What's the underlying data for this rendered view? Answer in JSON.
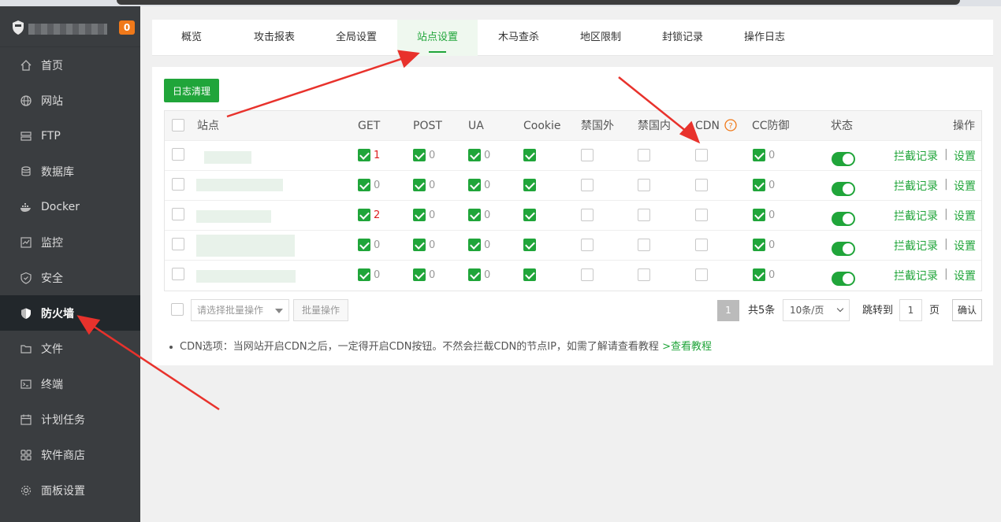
{
  "sidebar": {
    "badge": "0",
    "items": [
      {
        "label": "首页",
        "icon": "home-icon"
      },
      {
        "label": "网站",
        "icon": "globe-icon"
      },
      {
        "label": "FTP",
        "icon": "ftp-icon"
      },
      {
        "label": "数据库",
        "icon": "database-icon"
      },
      {
        "label": "Docker",
        "icon": "docker-icon"
      },
      {
        "label": "监控",
        "icon": "monitor-icon"
      },
      {
        "label": "安全",
        "icon": "security-shield-icon"
      },
      {
        "label": "防火墙",
        "icon": "firewall-shield-icon",
        "active": true
      },
      {
        "label": "文件",
        "icon": "folder-icon"
      },
      {
        "label": "终端",
        "icon": "terminal-icon"
      },
      {
        "label": "计划任务",
        "icon": "calendar-icon"
      },
      {
        "label": "软件商店",
        "icon": "grid-icon"
      },
      {
        "label": "面板设置",
        "icon": "gear-icon"
      }
    ]
  },
  "tabs": [
    "概览",
    "攻击报表",
    "全局设置",
    "站点设置",
    "木马查杀",
    "地区限制",
    "封锁记录",
    "操作日志"
  ],
  "active_tab": "站点设置",
  "toolbar": {
    "log_clear": "日志清理"
  },
  "table": {
    "headers": {
      "site": "站点",
      "get": "GET",
      "post": "POST",
      "ua": "UA",
      "cookie": "Cookie",
      "ban_foreign": "禁国外",
      "ban_domestic": "禁国内",
      "cdn": "CDN",
      "cc": "CC防御",
      "status": "状态",
      "ops": "操作"
    },
    "rows": [
      {
        "get": "1",
        "post": "0",
        "ua": "0",
        "cc": "0"
      },
      {
        "get": "0",
        "post": "0",
        "ua": "0",
        "cc": "0"
      },
      {
        "get": "2",
        "post": "0",
        "ua": "0",
        "cc": "0"
      },
      {
        "get": "0",
        "post": "0",
        "ua": "0",
        "cc": "0"
      },
      {
        "get": "0",
        "post": "0",
        "ua": "0",
        "cc": "0"
      }
    ],
    "op_links": {
      "intercept": "拦截记录",
      "sep": "|",
      "settings": "设置"
    }
  },
  "footer": {
    "batch_placeholder": "请选择批量操作",
    "batch_button": "批量操作",
    "page_current": "1",
    "page_total": "共5条",
    "page_size": "10条/页",
    "jump_label": "跳转到",
    "jump_value": "1",
    "jump_unit": "页",
    "confirm": "确认"
  },
  "note": {
    "text": "CDN选项：当网站开启CDN之后，一定得开启CDN按钮。不然会拦截CDN的节点IP，如需了解请查看教程 ",
    "link": ">查看教程"
  },
  "colors": {
    "accent": "#20a53a",
    "sidebar_bg": "#3a3d40",
    "arrow": "#e8322c"
  }
}
